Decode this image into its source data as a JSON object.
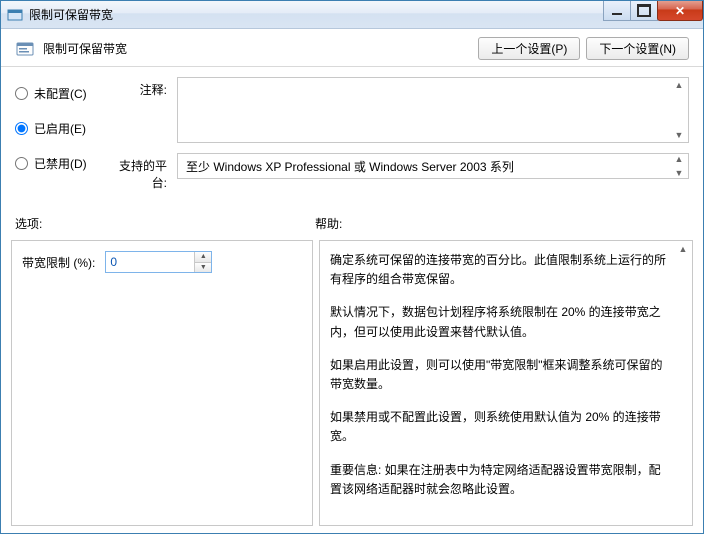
{
  "window": {
    "title": "限制可保留带宽",
    "blur_url": "jingyan.baidu.com"
  },
  "header": {
    "title": "限制可保留带宽",
    "prev_btn": "上一个设置(P)",
    "next_btn": "下一个设置(N)"
  },
  "radios": {
    "not_configured": "未配置(C)",
    "enabled": "已启用(E)",
    "disabled": "已禁用(D)",
    "selected": "enabled"
  },
  "fields": {
    "comment_label": "注释:",
    "comment_value": "",
    "platform_label": "支持的平台:",
    "platform_value": "至少 Windows XP Professional 或 Windows Server 2003 系列"
  },
  "sections": {
    "options_label": "选项:",
    "help_label": "帮助:"
  },
  "options": {
    "bandwidth_label": "带宽限制 (%):",
    "bandwidth_value": "0"
  },
  "help": {
    "p1": "确定系统可保留的连接带宽的百分比。此值限制系统上运行的所有程序的组合带宽保留。",
    "p2": "默认情况下，数据包计划程序将系统限制在 20% 的连接带宽之内，但可以使用此设置来替代默认值。",
    "p3": "如果启用此设置，则可以使用\"带宽限制\"框来调整系统可保留的带宽数量。",
    "p4": "如果禁用或不配置此设置，则系统使用默认值为 20% 的连接带宽。",
    "p5": "重要信息: 如果在注册表中为特定网络适配器设置带宽限制，配置该网络适配器时就会忽略此设置。"
  }
}
